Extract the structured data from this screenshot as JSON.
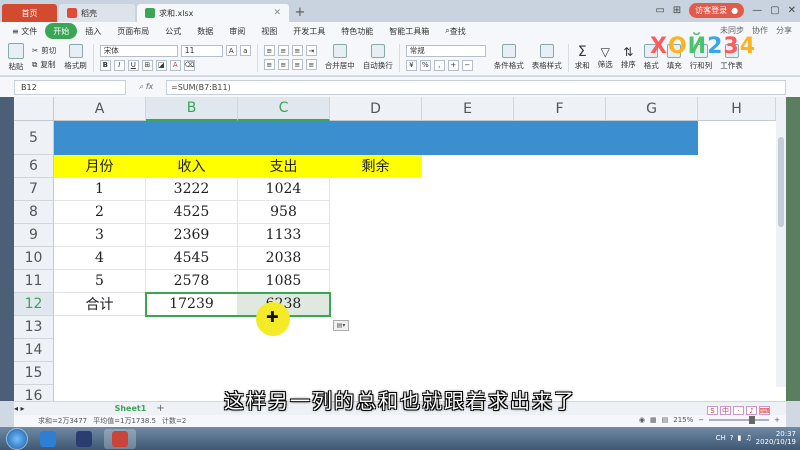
{
  "tabs": {
    "home": "首页",
    "docer": "稻壳",
    "file": "求和.xlsx",
    "add": "+"
  },
  "title_right": {
    "login": "访客登录"
  },
  "menu": {
    "file": "≡ 文件",
    "items": [
      "开始",
      "插入",
      "页面布局",
      "公式",
      "数据",
      "审阅",
      "视图",
      "开发工具",
      "特色功能",
      "智能工具箱"
    ],
    "search": "查找",
    "right": [
      "未同步",
      "协作",
      "分享"
    ]
  },
  "ribbon": {
    "paste": "粘贴",
    "cut": "剪切",
    "copy": "复制",
    "format_painter": "格式刷",
    "font_name": "宋体",
    "font_size": "11",
    "merge": "合并居中",
    "wrap": "自动换行",
    "number_format": "常规",
    "cond_format": "条件格式",
    "table_style": "表格样式",
    "sum": "求和",
    "filter": "筛选",
    "sort": "排序",
    "format": "格式",
    "fill": "填充",
    "rows_cols": "行和列",
    "worksheet": "工作表"
  },
  "logo": "ХОЙ234",
  "formula_bar": {
    "cell_ref": "B12",
    "fx": "fx",
    "formula": "=SUM(B7:B11)"
  },
  "columns": [
    "A",
    "B",
    "C",
    "D",
    "E",
    "F",
    "G",
    "H"
  ],
  "rows": [
    "5",
    "6",
    "7",
    "8",
    "9",
    "10",
    "11",
    "12",
    "13",
    "14",
    "15",
    "16"
  ],
  "table": {
    "headers": [
      "月份",
      "收入",
      "支出",
      "剩余"
    ],
    "data": [
      [
        "1",
        "3222",
        "1024"
      ],
      [
        "2",
        "4525",
        "958"
      ],
      [
        "3",
        "2369",
        "1133"
      ],
      [
        "4",
        "4545",
        "2038"
      ],
      [
        "5",
        "2578",
        "1085"
      ]
    ],
    "total_label": "合计",
    "total_b": "17239",
    "total_c": "6238"
  },
  "sheet_tab": "Sheet1",
  "status": {
    "sum": "求和=2万3477",
    "avg": "平均值=1万1738.5",
    "count": "计数=2",
    "zoom": "215%"
  },
  "subtitle": "这样另一列的总和也就跟着求出来了",
  "taskbar": {
    "lang": "CH",
    "time": "20:37",
    "date": "2020/10/19"
  },
  "colors": {
    "accent": "#3aa655",
    "header_yellow": "#ffff00",
    "band_blue": "#3c8fce"
  }
}
